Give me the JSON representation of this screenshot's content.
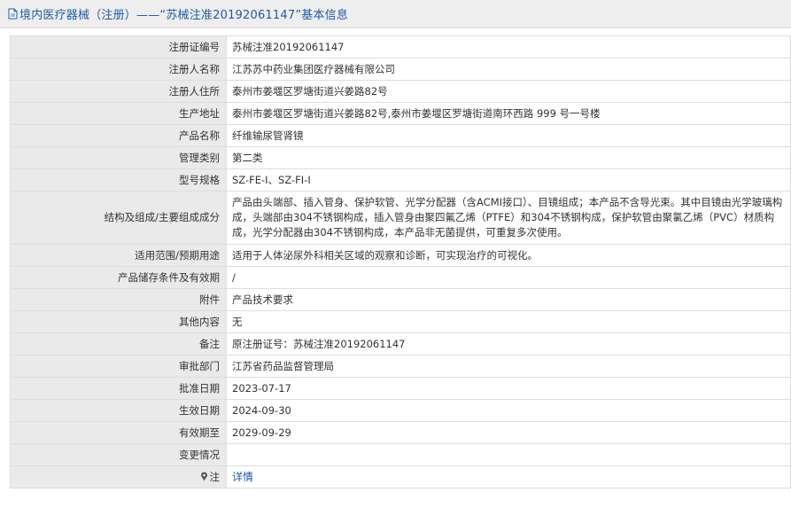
{
  "header": {
    "icon": "document-icon",
    "title": "境内医疗器械（注册）——“苏械注准20192061147”基本信息"
  },
  "rows": [
    {
      "label": "注册证编号",
      "value": "苏械注准20192061147"
    },
    {
      "label": "注册人名称",
      "value": "江苏苏中药业集团医疗器械有限公司"
    },
    {
      "label": "注册人住所",
      "value": "泰州市姜堰区罗塘街道兴姜路82号"
    },
    {
      "label": "生产地址",
      "value": "泰州市姜堰区罗塘街道兴姜路82号,泰州市姜堰区罗塘街道南环西路 999 号一号楼"
    },
    {
      "label": "产品名称",
      "value": "纤维输尿管肾镜"
    },
    {
      "label": "管理类别",
      "value": "第二类"
    },
    {
      "label": "型号规格",
      "value": "SZ-FE-I、SZ-FI-I"
    },
    {
      "label": "结构及组成/主要组成成分",
      "value": "产品由头端部、插入管身、保护软管、光学分配器（含ACMI接口）、目镜组成；本产品不含导光束。其中目镜由光学玻璃构成，头端部由304不锈钢构成，插入管身由聚四氟乙烯（PTFE）和304不锈钢构成，保护软管由聚氯乙烯（PVC）材质构成，光学分配器由304不锈钢构成，本产品非无菌提供，可重复多次使用。"
    },
    {
      "label": "适用范围/预期用途",
      "value": "适用于人体泌尿外科相关区域的观察和诊断，可实现治疗的可视化。"
    },
    {
      "label": "产品储存条件及有效期",
      "value": "/"
    },
    {
      "label": "附件",
      "value": "产品技术要求"
    },
    {
      "label": "其他内容",
      "value": "无"
    },
    {
      "label": "备注",
      "value": "原注册证号：苏械注准20192061147"
    },
    {
      "label": "审批部门",
      "value": "江苏省药品监督管理局"
    },
    {
      "label": "批准日期",
      "value": "2023-07-17"
    },
    {
      "label": "生效日期",
      "value": "2024-09-30"
    },
    {
      "label": "有效期至",
      "value": "2029-09-29"
    },
    {
      "label": "变更情况",
      "value": ""
    }
  ],
  "note": {
    "icon": "pin-icon",
    "label": "注",
    "link_text": "详情"
  },
  "colors": {
    "title_bar_bg": "#eeeeee",
    "label_bg": "#eaeaea",
    "border": "#dddddd",
    "link": "#1e5aa8"
  }
}
